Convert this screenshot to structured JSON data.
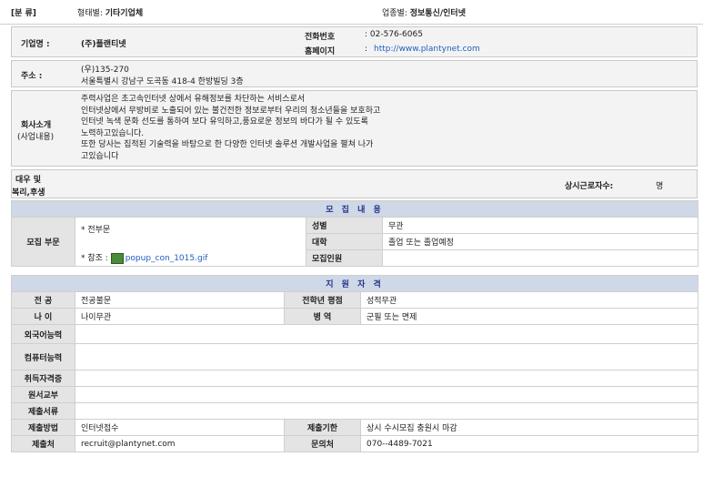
{
  "header": {
    "category_label": "[분 류]",
    "type_label": "형태별:",
    "type_value": "기타기업체",
    "industry_label": "업종별:",
    "industry_value": "정보통신/인터넷"
  },
  "company": {
    "name_label": "기업명 :",
    "name_value": "(주)플랜티넷",
    "phone_label": "전화번호",
    "phone_value": ": 02-576-6065",
    "homepage_label": "홈페이지",
    "homepage_sep": ":",
    "homepage_value": "http://www.plantynet.com"
  },
  "address": {
    "label": "주소 :",
    "zip": "(우)135-270",
    "line": "서울특별시 강남구 도곡동 418-4 한방빌딩 3층"
  },
  "intro": {
    "label_line1": "회사소개",
    "label_line2": "(사업내용)",
    "lines": [
      "주력사업은 초고속인터넷 상에서 유해정보를 차단하는 서비스로서",
      "인터넷상에서 무방비로 노출되어 있는 불건전한 정보로부터 우리의 청소년들을 보호하고",
      "인터넷 녹색 문화 선도를 통하여 보다 유익하고,풍요로운 정보의 바다가 될 수 있도록",
      "노력하고있습니다.",
      "또한 당사는 집적된 기술력을 바탕으로 한 다양한 인터넷 솔루션 개발사업을 펼쳐 나가",
      "고있습니다"
    ]
  },
  "welfare": {
    "label_line1": "대우 및",
    "label_line2": "복리,후생",
    "employees_label": "상시근로자수:",
    "employees_unit": "명"
  },
  "recruit": {
    "section_title": "모 집 내 용",
    "dept_label": "모집 부문",
    "dept_value": "* 전부문",
    "ref_label": "* 참조 :",
    "ref_file": "popup_con_1015.gif",
    "gender_label": "성별",
    "gender_value": "무관",
    "univ_label": "대학",
    "univ_value": "졸업 또는 졸업예정",
    "count_label": "모집인원",
    "count_value": ""
  },
  "qualify": {
    "section_title": "지 원 자 격",
    "major_label": "전 공",
    "major_value": "전공불문",
    "gpa_label": "전학년 평점",
    "gpa_value": "성적무관",
    "age_label": "나 이",
    "age_value": "나이무관",
    "military_label": "병 역",
    "military_value": "군필 또는 면제",
    "lang_label": "외국어능력",
    "computer_label": "컴퓨터능력",
    "cert_label": "취득자격증",
    "form_label": "원서교부",
    "docs_label": "제출서류",
    "method_label": "제출방법",
    "method_value": "인터넷접수",
    "deadline_label": "제출기한",
    "deadline_value": "상시 수시모집 충원시 마감",
    "dest_label": "제출처",
    "dest_value": "recruit@plantynet.com",
    "contact_label": "문의처",
    "contact_value": "070--4489-7021"
  }
}
